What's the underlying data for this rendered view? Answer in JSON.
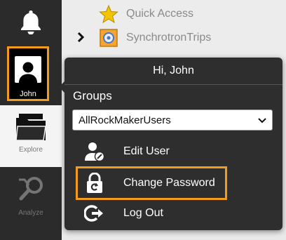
{
  "nav": {
    "user_label": "John",
    "explore_label": "Explore",
    "analyze_label": "Analyze"
  },
  "tree": {
    "items": [
      {
        "label": "Quick Access",
        "icon": "star-icon"
      },
      {
        "label": "SynchrotronTrips",
        "icon": "synchrotron-icon"
      }
    ]
  },
  "popup": {
    "greeting": "Hi, John",
    "groups_label": "Groups",
    "groups_selected": "AllRockMakerUsers",
    "menu": [
      {
        "label": "Edit User",
        "icon": "edit-user-icon"
      },
      {
        "label": "Change Password",
        "icon": "lock-refresh-icon"
      },
      {
        "label": "Log Out",
        "icon": "logout-icon"
      }
    ]
  },
  "colors": {
    "highlight": "#f39b1f",
    "nav_bg": "#2b2b2b",
    "popup_bg": "#2e2e2e"
  }
}
